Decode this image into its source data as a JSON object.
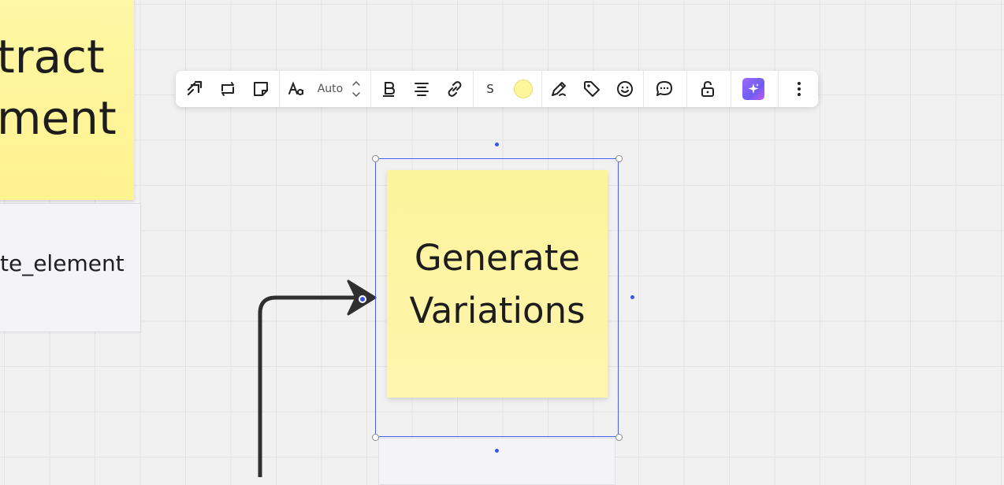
{
  "canvas": {
    "left_sticky_text": "tract\nment",
    "left_card_text": "te_element",
    "bottom_card_text": "... ",
    "main_sticky_text": "Generate Variations"
  },
  "toolbar": {
    "font_size_label": "Auto",
    "shape_size_label": "S",
    "sticky_color": "#fff59b",
    "items": [
      {
        "icon": "convert-to-icon"
      },
      {
        "icon": "switch-type-icon"
      },
      {
        "icon": "sticky-note-icon"
      },
      {
        "icon": "font-family-icon"
      },
      {
        "icon": "font-size-stepper"
      },
      {
        "icon": "bold-icon"
      },
      {
        "icon": "align-center-icon"
      },
      {
        "icon": "link-icon"
      },
      {
        "icon": "size-selector"
      },
      {
        "icon": "color-swatch"
      },
      {
        "icon": "draw-pen-icon"
      },
      {
        "icon": "tag-icon"
      },
      {
        "icon": "emoji-icon"
      },
      {
        "icon": "comment-icon"
      },
      {
        "icon": "lock-icon"
      },
      {
        "icon": "ai-sparkle-icon"
      },
      {
        "icon": "more-icon"
      }
    ]
  },
  "colors": {
    "selection": "#4a62f0",
    "sticky_yellow": "#fff59b",
    "connector": "#2f2f2f",
    "ai_accent": "#8a63f7"
  }
}
